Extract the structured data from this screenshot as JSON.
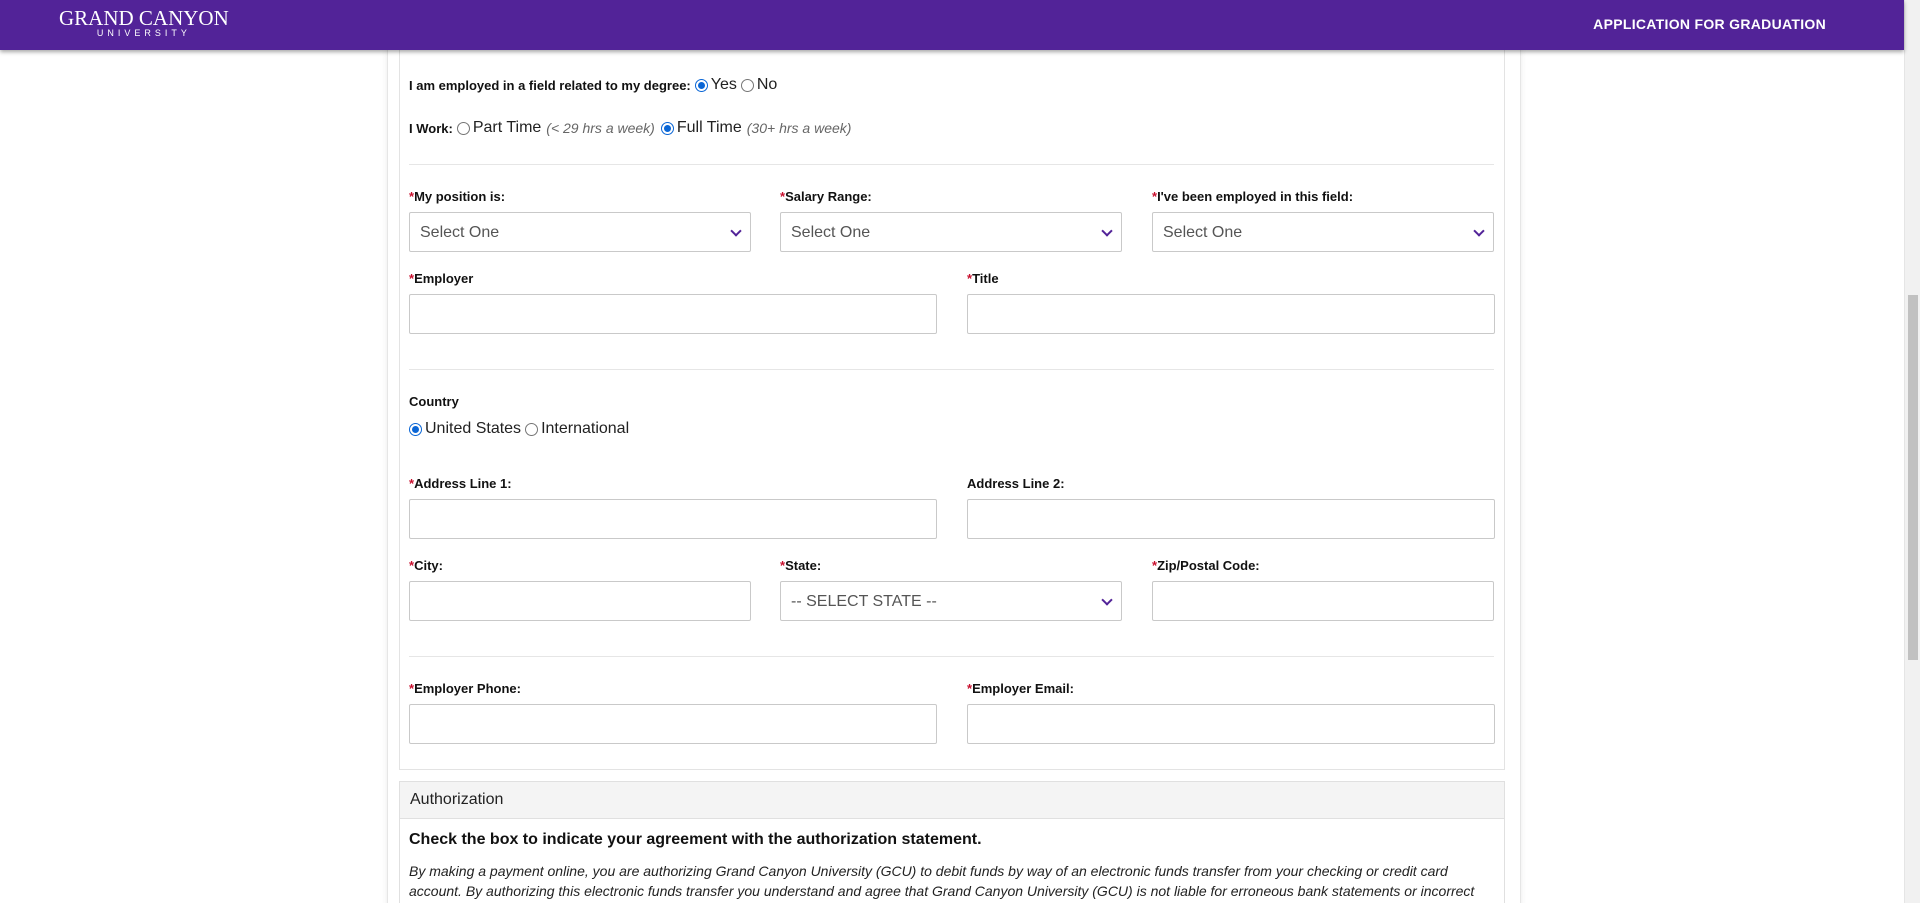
{
  "header": {
    "logo_main": "GRAND CANYON",
    "logo_sub": "UNIVERSITY",
    "title": "APPLICATION FOR GRADUATION"
  },
  "employment": {
    "related_label": "I am employed in a field related to my degree:",
    "related_options": [
      "Yes",
      "No"
    ],
    "related_selected": "Yes",
    "work_label": "I Work:",
    "part_time": "Part Time",
    "part_time_hint": "(< 29 hrs a week)",
    "full_time": "Full Time",
    "full_time_hint": "(30+ hrs a week)",
    "work_selected": "Full Time"
  },
  "position": {
    "required_mark": "*",
    "position_label": "My position is:",
    "position_value": "Select One",
    "salary_label": "Salary Range:",
    "salary_value": "Select One",
    "tenure_label": "I've been employed in this field:",
    "tenure_value": "Select One",
    "employer_label": "Employer",
    "title_label": "Title"
  },
  "address": {
    "country_label": "Country",
    "country_us": "United States",
    "country_intl": "International",
    "country_selected": "United States",
    "line1_label": "Address Line 1:",
    "line2_label": "Address Line 2:",
    "city_label": "City:",
    "state_label": "State:",
    "state_value": "-- SELECT STATE --",
    "zip_label": "Zip/Postal Code:"
  },
  "contact": {
    "phone_label": "Employer Phone:",
    "email_label": "Employer Email:"
  },
  "authorization": {
    "heading": "Authorization",
    "instruction": "Check the box to indicate your agreement with the authorization statement.",
    "statement": "By making a payment online, you are authorizing Grand Canyon University (GCU) to debit funds by way of an electronic funds transfer from your checking or credit card account. By authorizing this electronic funds transfer you understand and agree that Grand Canyon University (GCU) is not liable for erroneous bank statements or incorrect"
  },
  "colors": {
    "brand": "#522398",
    "required": "#c8102e",
    "radio_selected": "#0a66d6"
  }
}
